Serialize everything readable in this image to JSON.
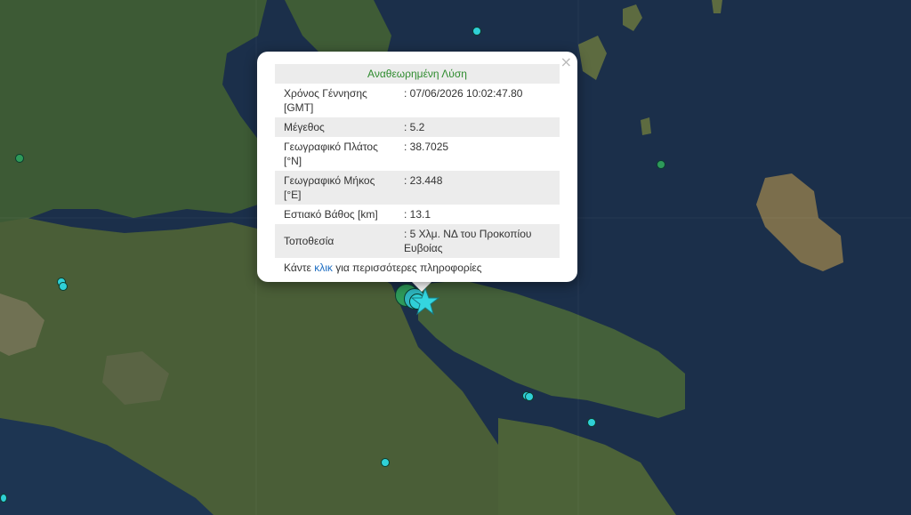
{
  "popup": {
    "title": "Αναθεωρημένη Λύση",
    "close_glyph": "×",
    "rows": [
      {
        "label": "Χρόνος Γέννησης [GMT]",
        "value": ": 07/06/2026 10:02:47.80"
      },
      {
        "label": "Μέγεθος",
        "value": ": 5.2"
      },
      {
        "label": "Γεωγραφικό Πλάτος [°N]",
        "value": ": 38.7025"
      },
      {
        "label": "Γεωγραφικό Μήκος [°E]",
        "value": ": 23.448"
      },
      {
        "label": "Εστιακό Βάθος [km]",
        "value": ": 13.1"
      },
      {
        "label": "Τοποθεσία",
        "value": ": 5 Χλμ. ΝΔ του Προκοπίου Ευβοίας"
      }
    ],
    "footer_prefix": "Κάντε ",
    "footer_link": "κλικ",
    "footer_suffix": " για περισσότερες πληροφορίες"
  },
  "colors": {
    "sea": "#1b2f4a",
    "land": "#3c5a33",
    "quake_cyan": "#2fd0d6",
    "quake_green": "#2e9a5a",
    "epicenter_star": "#34d6e0"
  },
  "markers": {
    "epicenter_icon": "star-icon",
    "event_icon": "circle-marker-icon"
  }
}
